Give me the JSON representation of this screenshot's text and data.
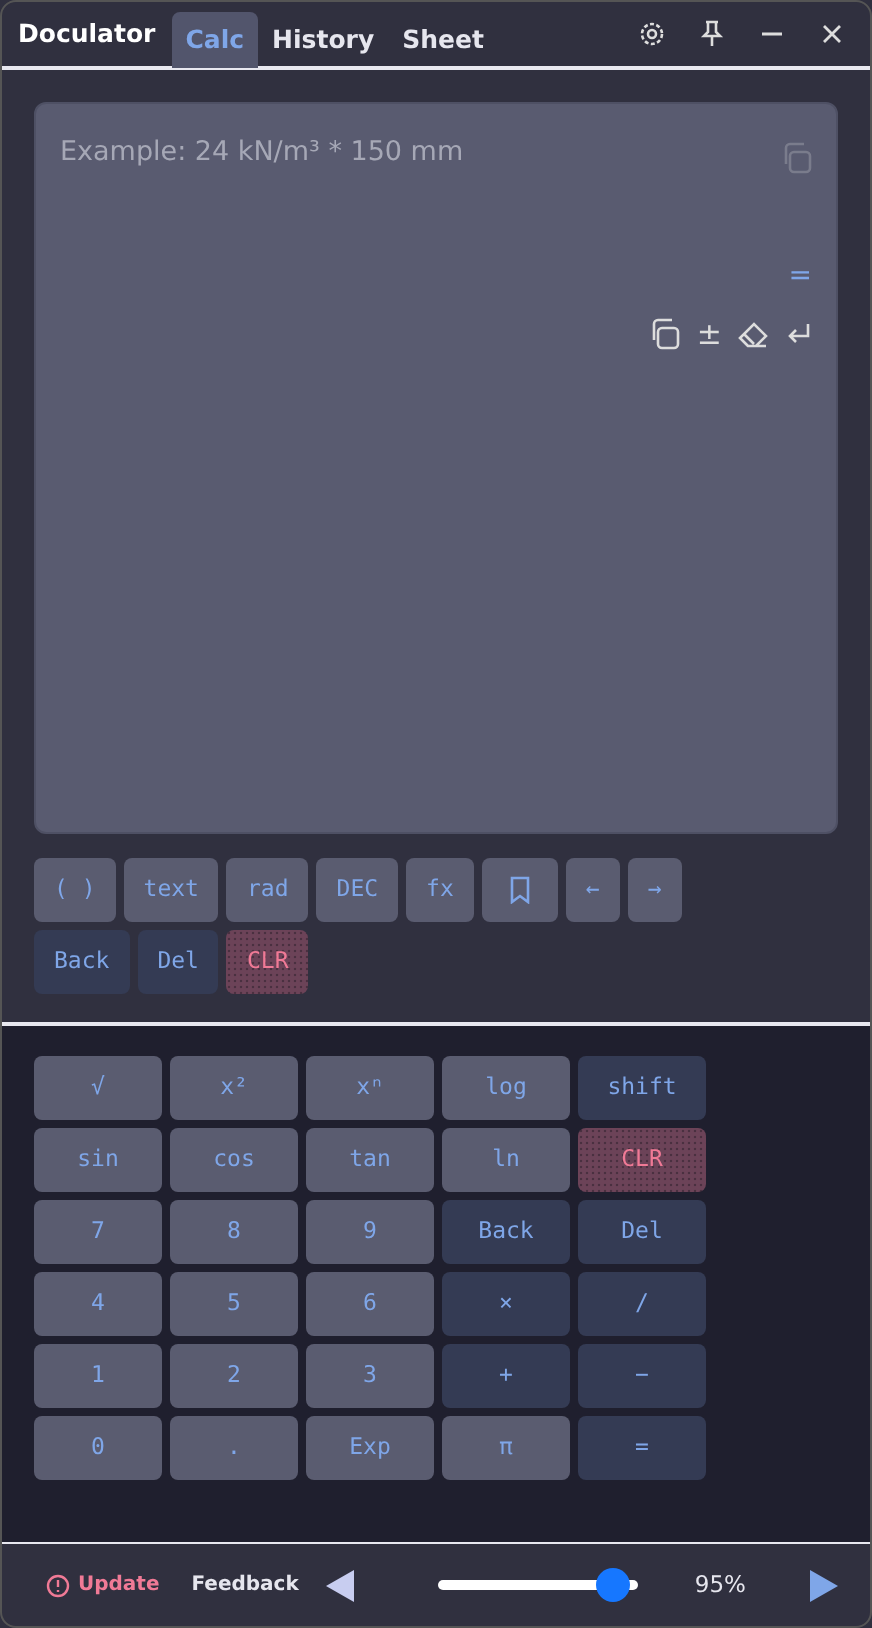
{
  "window": {
    "title": "Doculator"
  },
  "tabs": [
    {
      "label": "Calc",
      "selected": true
    },
    {
      "label": "History",
      "selected": false
    },
    {
      "label": "Sheet",
      "selected": false
    }
  ],
  "input": {
    "placeholder": "Example: 24 kN/m³ * 150 mm",
    "result": "=",
    "sign_toggle": "±"
  },
  "toolbar": [
    [
      {
        "label": "( )",
        "kind": "normal"
      },
      {
        "label": "text",
        "kind": "normal"
      },
      {
        "label": "rad",
        "kind": "normal"
      },
      {
        "label": "DEC",
        "kind": "normal"
      },
      {
        "label": "fx",
        "kind": "normal"
      },
      {
        "kind": "bookmark"
      },
      {
        "label": "←",
        "kind": "normal"
      },
      {
        "label": "→",
        "kind": "normal"
      }
    ],
    [
      {
        "label": "Back",
        "kind": "dark"
      },
      {
        "label": "Del",
        "kind": "dark"
      },
      {
        "label": "CLR",
        "kind": "danger"
      }
    ]
  ],
  "keypad": [
    {
      "label": "√",
      "kind": "normal"
    },
    {
      "label": "x²",
      "kind": "normal"
    },
    {
      "label": "xⁿ",
      "kind": "normal"
    },
    {
      "label": "log",
      "kind": "normal"
    },
    {
      "label": "shift",
      "kind": "dark"
    },
    {
      "label": "sin",
      "kind": "normal"
    },
    {
      "label": "cos",
      "kind": "normal"
    },
    {
      "label": "tan",
      "kind": "normal"
    },
    {
      "label": "ln",
      "kind": "normal"
    },
    {
      "label": "CLR",
      "kind": "danger"
    },
    {
      "label": "7",
      "kind": "normal"
    },
    {
      "label": "8",
      "kind": "normal"
    },
    {
      "label": "9",
      "kind": "normal"
    },
    {
      "label": "Back",
      "kind": "dark"
    },
    {
      "label": "Del",
      "kind": "dark"
    },
    {
      "label": "4",
      "kind": "normal"
    },
    {
      "label": "5",
      "kind": "normal"
    },
    {
      "label": "6",
      "kind": "normal"
    },
    {
      "label": "×",
      "kind": "dark"
    },
    {
      "label": "/",
      "kind": "dark"
    },
    {
      "label": "1",
      "kind": "normal"
    },
    {
      "label": "2",
      "kind": "normal"
    },
    {
      "label": "3",
      "kind": "normal"
    },
    {
      "label": "+",
      "kind": "dark"
    },
    {
      "label": "−",
      "kind": "dark"
    },
    {
      "label": "0",
      "kind": "normal"
    },
    {
      "label": ".",
      "kind": "normal"
    },
    {
      "label": "Exp",
      "kind": "normal"
    },
    {
      "label": "π",
      "kind": "normal"
    },
    {
      "label": "=",
      "kind": "dark"
    }
  ],
  "footer": {
    "update": "Update",
    "feedback": "Feedback",
    "zoom": {
      "level": 0.87,
      "reading": "95%"
    }
  }
}
